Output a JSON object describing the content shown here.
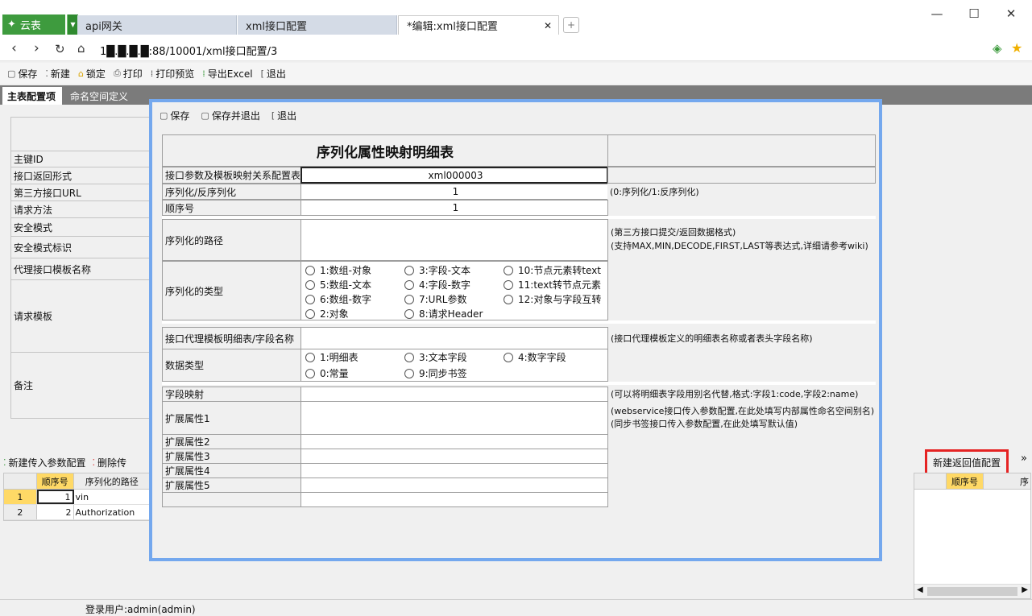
{
  "app": {
    "name": "云表"
  },
  "tabs": [
    {
      "label": "api网关"
    },
    {
      "label": "xml接口配置"
    },
    {
      "label": "*编辑:xml接口配置"
    }
  ],
  "window": {
    "min": "—",
    "max": "☐",
    "close": "✕"
  },
  "address": {
    "url": "1█.█.█.█:88/10001/xml接口配置/3"
  },
  "toolbar": {
    "save": "保存",
    "new": "新建",
    "lock": "锁定",
    "print": "打印",
    "print_preview": "打印预览",
    "export": "导出Excel",
    "exit": "退出"
  },
  "page_tabs": [
    {
      "label": "主表配置项"
    },
    {
      "label": "命名空间定义"
    }
  ],
  "left_fields": [
    "主键ID",
    "接口返回形式",
    "第三方接口URL",
    "请求方法",
    "安全模式",
    "安全模式标识",
    "代理接口模板名称",
    "请求模板",
    "备注"
  ],
  "bottom_toolbar": {
    "new_param": "新建传入参数配置",
    "delete_param": "删除传"
  },
  "grid": {
    "headers": [
      "顺序号",
      "序列化的路径"
    ],
    "rows": [
      {
        "num": "1",
        "seq": "1",
        "path": "vin"
      },
      {
        "num": "2",
        "seq": "2",
        "path": "Authorization"
      }
    ]
  },
  "right_grid": {
    "header": "顺序号",
    "header2": "序",
    "new_button": "新建返回值配置",
    "more": "»"
  },
  "status": {
    "user": "登录用户:admin(admin)"
  },
  "modal": {
    "toolbar": {
      "save": "保存",
      "save_exit": "保存并退出",
      "exit": "退出"
    },
    "title": "序列化属性映射明细表",
    "fields": {
      "mapping_label": "接口参数及模板映射关系配置表",
      "mapping_value": "xml000003",
      "serialize_label": "序列化/反序列化",
      "serialize_value": "1",
      "serialize_note": "(0:序列化/1:反序列化)",
      "order_label": "顺序号",
      "order_value": "1",
      "path_label": "序列化的路径",
      "path_note1": "(第三方接口提交/返回数据格式)",
      "path_note2": "(支持MAX,MIN,DECODE,FIRST,LAST等表达式,详细请参考wiki)",
      "type_label": "序列化的类型",
      "type_options": [
        "1:数组-对象",
        "3:字段-文本",
        "10:节点元素转text",
        "5:数组-文本",
        "4:字段-数字",
        "11:text转节点元素",
        "6:数组-数字",
        "7:URL参数",
        "12:对象与字段互转",
        "2:对象",
        "8:请求Header"
      ],
      "proxy_label": "接口代理模板明细表/字段名称",
      "proxy_note": "(接口代理模板定义的明细表名称或者表头字段名称)",
      "datatype_label": "数据类型",
      "datatype_options": [
        "1:明细表",
        "3:文本字段",
        "4:数字字段",
        "0:常量",
        "9:同步书签"
      ],
      "fieldmap_label": "字段映射",
      "fieldmap_note": "(可以将明细表字段用别名代替,格式:字段1:code,字段2:name)",
      "ext1_label": "扩展属性1",
      "ext1_note1": "(webservice接口传入参数配置,在此处填写内部属性命名空间别名)",
      "ext1_note2": "(同步书签接口传入参数配置,在此处填写默认值)",
      "ext2_label": "扩展属性2",
      "ext3_label": "扩展属性3",
      "ext4_label": "扩展属性4",
      "ext5_label": "扩展属性5"
    }
  }
}
